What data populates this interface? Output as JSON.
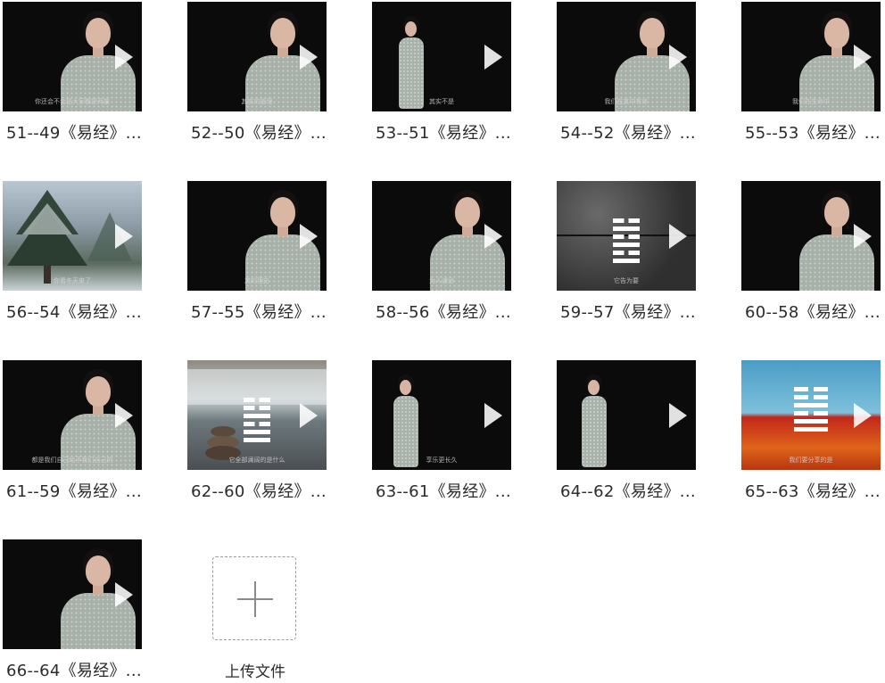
{
  "videos": [
    {
      "title": "51--49《易经》...",
      "caption": "你还会不会是大家都是两量"
    },
    {
      "title": "52--50《易经》...",
      "caption": "其实的道理"
    },
    {
      "title": "53--51《易经》...",
      "caption": "其实不是"
    },
    {
      "title": "54--52《易经》...",
      "caption": "我们在其中有序"
    },
    {
      "title": "55--53《易经》...",
      "caption": "我们在生命中"
    },
    {
      "title": "56--54《易经》...",
      "caption": "你看冬天来了"
    },
    {
      "title": "57--55《易经》...",
      "caption": "其的理由"
    },
    {
      "title": "58--56《易经》...",
      "caption": "为人谦逊"
    },
    {
      "title": "59--57《易经》...",
      "caption": "它告为要"
    },
    {
      "title": "60--58《易经》...",
      "caption": ""
    },
    {
      "title": "61--59《易经》...",
      "caption": "都是我们自己给予我们自己的"
    },
    {
      "title": "62--60《易经》...",
      "caption": "它全部澜阔的是什么"
    },
    {
      "title": "63--61《易经》...",
      "caption": "享乐更长久"
    },
    {
      "title": "64--62《易经》...",
      "caption": ""
    },
    {
      "title": "65--63《易经》...",
      "caption": "我们要分享的是"
    },
    {
      "title": "66--64《易经》...",
      "caption": ""
    }
  ],
  "upload": {
    "label": "上传文件"
  }
}
